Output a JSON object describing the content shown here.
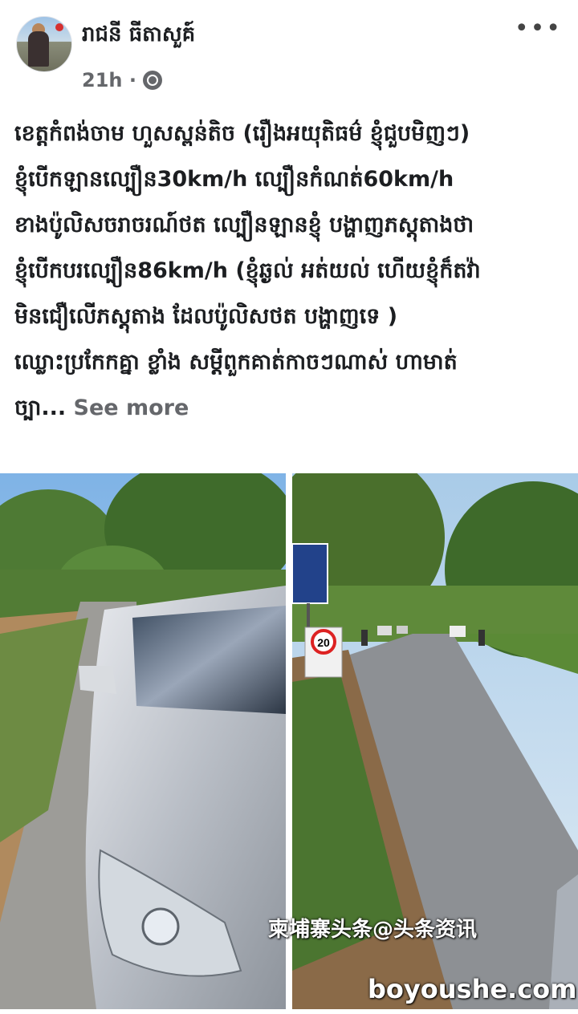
{
  "author": {
    "name": "រាជនី ធីតាសួគ៍"
  },
  "meta": {
    "time": "21h ·",
    "privacy_icon": "globe-icon"
  },
  "menu_icon": "more-options-icon",
  "post": {
    "lines": [
      "ខេត្តកំពង់ចាម ហួសស្ពន់តិច (រឿងអយុតិធម៌ ខ្ញុំជួបមិញៗ)",
      "ខ្ញុំបើកឡានល្បឿន30km/h ល្បឿនកំណត់60km/h",
      "ខាងប៉ូលិសចរាចរណ៍ថត ល្បឿនឡានខ្ញុំ បង្ហាញភស្តុតាងថា",
      "ខ្ញុំបើកបរល្បឿន86km/h (ខ្ញុំឆ្ងល់ អត់យល់ ហើយខ្ញុំក៏តវ៉ា",
      "មិនជឿលើភស្តុតាង ដែលប៉ូលិសថត បង្ហាញទេ )",
      "ឈ្លោះប្រកែកគ្នា ខ្លាំង សម្តីពួកគាត់កាចៗណាស់ ហាមាត់"
    ],
    "last_line": "ច្បា...",
    "see_more": "See more"
  },
  "photos": {
    "speed_sign": "20",
    "watermark_cn": "柬埔寨头条@头条资讯",
    "watermark_site": "boyoushe.com"
  },
  "colors": {
    "text": "#1c1e21",
    "secondary": "#65676b",
    "background": "#ffffff"
  }
}
